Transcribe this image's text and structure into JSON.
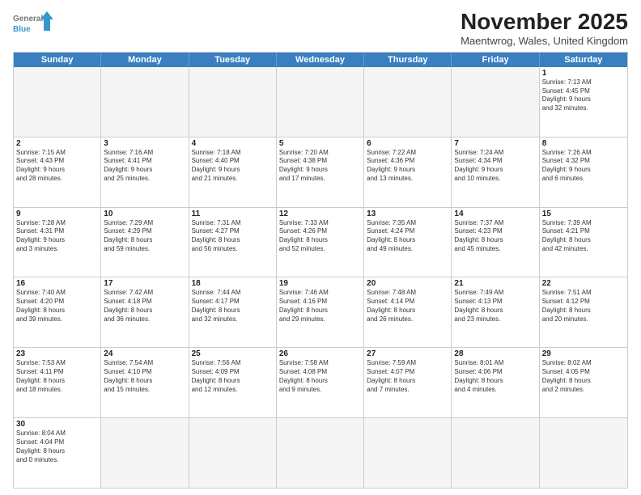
{
  "header": {
    "logo_general": "General",
    "logo_blue": "Blue",
    "title": "November 2025",
    "subtitle": "Maentwrog, Wales, United Kingdom"
  },
  "days": [
    "Sunday",
    "Monday",
    "Tuesday",
    "Wednesday",
    "Thursday",
    "Friday",
    "Saturday"
  ],
  "rows": [
    [
      {
        "day": "",
        "empty": true
      },
      {
        "day": "",
        "empty": true
      },
      {
        "day": "",
        "empty": true
      },
      {
        "day": "",
        "empty": true
      },
      {
        "day": "",
        "empty": true
      },
      {
        "day": "",
        "empty": true
      },
      {
        "day": "1",
        "lines": [
          "Sunrise: 7:13 AM",
          "Sunset: 4:45 PM",
          "Daylight: 9 hours",
          "and 32 minutes."
        ]
      }
    ],
    [
      {
        "day": "2",
        "lines": [
          "Sunrise: 7:15 AM",
          "Sunset: 4:43 PM",
          "Daylight: 9 hours",
          "and 28 minutes."
        ]
      },
      {
        "day": "3",
        "lines": [
          "Sunrise: 7:16 AM",
          "Sunset: 4:41 PM",
          "Daylight: 9 hours",
          "and 25 minutes."
        ]
      },
      {
        "day": "4",
        "lines": [
          "Sunrise: 7:18 AM",
          "Sunset: 4:40 PM",
          "Daylight: 9 hours",
          "and 21 minutes."
        ]
      },
      {
        "day": "5",
        "lines": [
          "Sunrise: 7:20 AM",
          "Sunset: 4:38 PM",
          "Daylight: 9 hours",
          "and 17 minutes."
        ]
      },
      {
        "day": "6",
        "lines": [
          "Sunrise: 7:22 AM",
          "Sunset: 4:36 PM",
          "Daylight: 9 hours",
          "and 13 minutes."
        ]
      },
      {
        "day": "7",
        "lines": [
          "Sunrise: 7:24 AM",
          "Sunset: 4:34 PM",
          "Daylight: 9 hours",
          "and 10 minutes."
        ]
      },
      {
        "day": "8",
        "lines": [
          "Sunrise: 7:26 AM",
          "Sunset: 4:32 PM",
          "Daylight: 9 hours",
          "and 6 minutes."
        ]
      }
    ],
    [
      {
        "day": "9",
        "lines": [
          "Sunrise: 7:28 AM",
          "Sunset: 4:31 PM",
          "Daylight: 9 hours",
          "and 3 minutes."
        ]
      },
      {
        "day": "10",
        "lines": [
          "Sunrise: 7:29 AM",
          "Sunset: 4:29 PM",
          "Daylight: 8 hours",
          "and 59 minutes."
        ]
      },
      {
        "day": "11",
        "lines": [
          "Sunrise: 7:31 AM",
          "Sunset: 4:27 PM",
          "Daylight: 8 hours",
          "and 56 minutes."
        ]
      },
      {
        "day": "12",
        "lines": [
          "Sunrise: 7:33 AM",
          "Sunset: 4:26 PM",
          "Daylight: 8 hours",
          "and 52 minutes."
        ]
      },
      {
        "day": "13",
        "lines": [
          "Sunrise: 7:35 AM",
          "Sunset: 4:24 PM",
          "Daylight: 8 hours",
          "and 49 minutes."
        ]
      },
      {
        "day": "14",
        "lines": [
          "Sunrise: 7:37 AM",
          "Sunset: 4:23 PM",
          "Daylight: 8 hours",
          "and 45 minutes."
        ]
      },
      {
        "day": "15",
        "lines": [
          "Sunrise: 7:39 AM",
          "Sunset: 4:21 PM",
          "Daylight: 8 hours",
          "and 42 minutes."
        ]
      }
    ],
    [
      {
        "day": "16",
        "lines": [
          "Sunrise: 7:40 AM",
          "Sunset: 4:20 PM",
          "Daylight: 8 hours",
          "and 39 minutes."
        ]
      },
      {
        "day": "17",
        "lines": [
          "Sunrise: 7:42 AM",
          "Sunset: 4:18 PM",
          "Daylight: 8 hours",
          "and 36 minutes."
        ]
      },
      {
        "day": "18",
        "lines": [
          "Sunrise: 7:44 AM",
          "Sunset: 4:17 PM",
          "Daylight: 8 hours",
          "and 32 minutes."
        ]
      },
      {
        "day": "19",
        "lines": [
          "Sunrise: 7:46 AM",
          "Sunset: 4:16 PM",
          "Daylight: 8 hours",
          "and 29 minutes."
        ]
      },
      {
        "day": "20",
        "lines": [
          "Sunrise: 7:48 AM",
          "Sunset: 4:14 PM",
          "Daylight: 8 hours",
          "and 26 minutes."
        ]
      },
      {
        "day": "21",
        "lines": [
          "Sunrise: 7:49 AM",
          "Sunset: 4:13 PM",
          "Daylight: 8 hours",
          "and 23 minutes."
        ]
      },
      {
        "day": "22",
        "lines": [
          "Sunrise: 7:51 AM",
          "Sunset: 4:12 PM",
          "Daylight: 8 hours",
          "and 20 minutes."
        ]
      }
    ],
    [
      {
        "day": "23",
        "lines": [
          "Sunrise: 7:53 AM",
          "Sunset: 4:11 PM",
          "Daylight: 8 hours",
          "and 18 minutes."
        ]
      },
      {
        "day": "24",
        "lines": [
          "Sunrise: 7:54 AM",
          "Sunset: 4:10 PM",
          "Daylight: 8 hours",
          "and 15 minutes."
        ]
      },
      {
        "day": "25",
        "lines": [
          "Sunrise: 7:56 AM",
          "Sunset: 4:09 PM",
          "Daylight: 8 hours",
          "and 12 minutes."
        ]
      },
      {
        "day": "26",
        "lines": [
          "Sunrise: 7:58 AM",
          "Sunset: 4:08 PM",
          "Daylight: 8 hours",
          "and 9 minutes."
        ]
      },
      {
        "day": "27",
        "lines": [
          "Sunrise: 7:59 AM",
          "Sunset: 4:07 PM",
          "Daylight: 8 hours",
          "and 7 minutes."
        ]
      },
      {
        "day": "28",
        "lines": [
          "Sunrise: 8:01 AM",
          "Sunset: 4:06 PM",
          "Daylight: 8 hours",
          "and 4 minutes."
        ]
      },
      {
        "day": "29",
        "lines": [
          "Sunrise: 8:02 AM",
          "Sunset: 4:05 PM",
          "Daylight: 8 hours",
          "and 2 minutes."
        ]
      }
    ],
    [
      {
        "day": "30",
        "lines": [
          "Sunrise: 8:04 AM",
          "Sunset: 4:04 PM",
          "Daylight: 8 hours",
          "and 0 minutes."
        ]
      },
      {
        "day": "",
        "empty": true
      },
      {
        "day": "",
        "empty": true
      },
      {
        "day": "",
        "empty": true
      },
      {
        "day": "",
        "empty": true
      },
      {
        "day": "",
        "empty": true
      },
      {
        "day": "",
        "empty": true
      }
    ]
  ]
}
